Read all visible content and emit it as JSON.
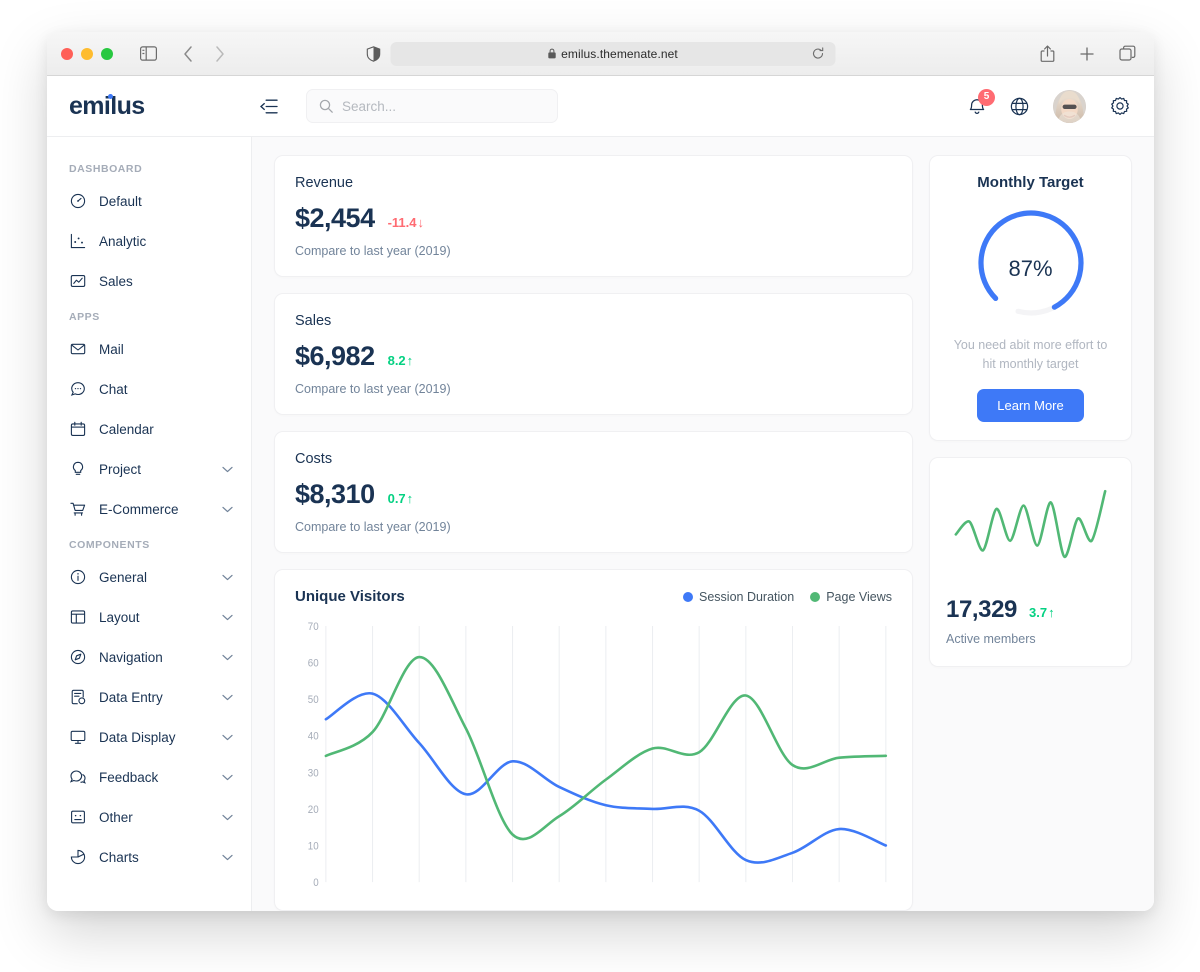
{
  "browser": {
    "url": "emilus.themenate.net",
    "lock_icon": "lock-icon",
    "shield_icon": "shield-icon",
    "reload_icon": "reload-icon",
    "sidebar_icon": "sidebar-toggle-icon",
    "back_icon": "chevron-left-icon",
    "forward_icon": "chevron-right-icon",
    "share_icon": "share-icon",
    "new_tab_icon": "plus-icon",
    "tabs_icon": "tab-overview-icon"
  },
  "header": {
    "logo": "emilus",
    "collapse_icon": "menu-fold-icon",
    "search": {
      "placeholder": "Search...",
      "value": "",
      "icon": "search-icon"
    },
    "notification": {
      "icon": "bell-icon",
      "count": "5"
    },
    "language_icon": "globe-icon",
    "avatar": "user-avatar",
    "settings_icon": "gear-icon"
  },
  "sidebar": {
    "sections": [
      {
        "title": "DASHBOARD",
        "items": [
          {
            "label": "Default",
            "icon": "dashboard-gauge-icon",
            "expandable": false
          },
          {
            "label": "Analytic",
            "icon": "analytics-chart-icon",
            "expandable": false
          },
          {
            "label": "Sales",
            "icon": "sales-trend-icon",
            "expandable": false
          }
        ]
      },
      {
        "title": "APPS",
        "items": [
          {
            "label": "Mail",
            "icon": "mail-icon",
            "expandable": false
          },
          {
            "label": "Chat",
            "icon": "chat-icon",
            "expandable": false
          },
          {
            "label": "Calendar",
            "icon": "calendar-icon",
            "expandable": false
          },
          {
            "label": "Project",
            "icon": "bulb-icon",
            "expandable": true
          },
          {
            "label": "E-Commerce",
            "icon": "cart-icon",
            "expandable": true
          }
        ]
      },
      {
        "title": "COMPONENTS",
        "items": [
          {
            "label": "General",
            "icon": "info-circle-icon",
            "expandable": true
          },
          {
            "label": "Layout",
            "icon": "layout-icon",
            "expandable": true
          },
          {
            "label": "Navigation",
            "icon": "compass-icon",
            "expandable": true
          },
          {
            "label": "Data Entry",
            "icon": "form-icon",
            "expandable": true
          },
          {
            "label": "Data Display",
            "icon": "desktop-icon",
            "expandable": true
          },
          {
            "label": "Feedback",
            "icon": "message-icon",
            "expandable": true
          },
          {
            "label": "Other",
            "icon": "face-icon",
            "expandable": true
          },
          {
            "label": "Charts",
            "icon": "pie-chart-icon",
            "expandable": true
          }
        ]
      }
    ],
    "chevron_icon": "chevron-down-icon"
  },
  "stats": [
    {
      "title": "Revenue",
      "value": "$2,454",
      "delta": "-11.4",
      "direction": "down",
      "arrow": "↓",
      "subtitle": "Compare to last year (2019)"
    },
    {
      "title": "Sales",
      "value": "$6,982",
      "delta": "8.2",
      "direction": "up",
      "arrow": "↑",
      "subtitle": "Compare to last year (2019)"
    },
    {
      "title": "Costs",
      "value": "$8,310",
      "delta": "0.7",
      "direction": "up",
      "arrow": "↑",
      "subtitle": "Compare to last year (2019)"
    }
  ],
  "monthly_target": {
    "title": "Monthly Target",
    "percent_label": "87%",
    "percent_value": 87,
    "description": "You need abit more effort to hit monthly target",
    "button_label": "Learn More",
    "accent_color": "#3e79f7",
    "track_color": "#f4f4f6"
  },
  "active_members": {
    "value": "17,329",
    "delta": "3.7",
    "direction": "up",
    "arrow": "↑",
    "label": "Active members",
    "line_color": "#51b875"
  },
  "colors": {
    "accent": "#3e79f7",
    "green": "#04d182",
    "red": "#ff6b72",
    "dark": "#1a3353",
    "muted": "#72849a"
  },
  "chart_data": {
    "type": "line",
    "title": "Unique Visitors",
    "xlabel": "",
    "ylabel": "",
    "ylim": [
      0,
      70
    ],
    "yticks": [
      0,
      10,
      20,
      30,
      40,
      50,
      60,
      70
    ],
    "grid": "vertical",
    "legend_position": "top-right",
    "x": [
      1,
      2,
      3,
      4,
      5,
      6,
      7,
      8,
      9,
      10,
      11,
      12,
      13
    ],
    "series": [
      {
        "name": "Session Duration",
        "color": "#3e79f7",
        "values": [
          44.5,
          51.5,
          38,
          24,
          33,
          26,
          21,
          20,
          19.5,
          6,
          8,
          14.5,
          10
        ]
      },
      {
        "name": "Page Views",
        "color": "#51b875",
        "values": [
          34.5,
          41,
          61.5,
          42,
          13,
          18,
          28,
          36.5,
          35.5,
          51,
          32,
          34,
          34.5
        ]
      }
    ]
  }
}
